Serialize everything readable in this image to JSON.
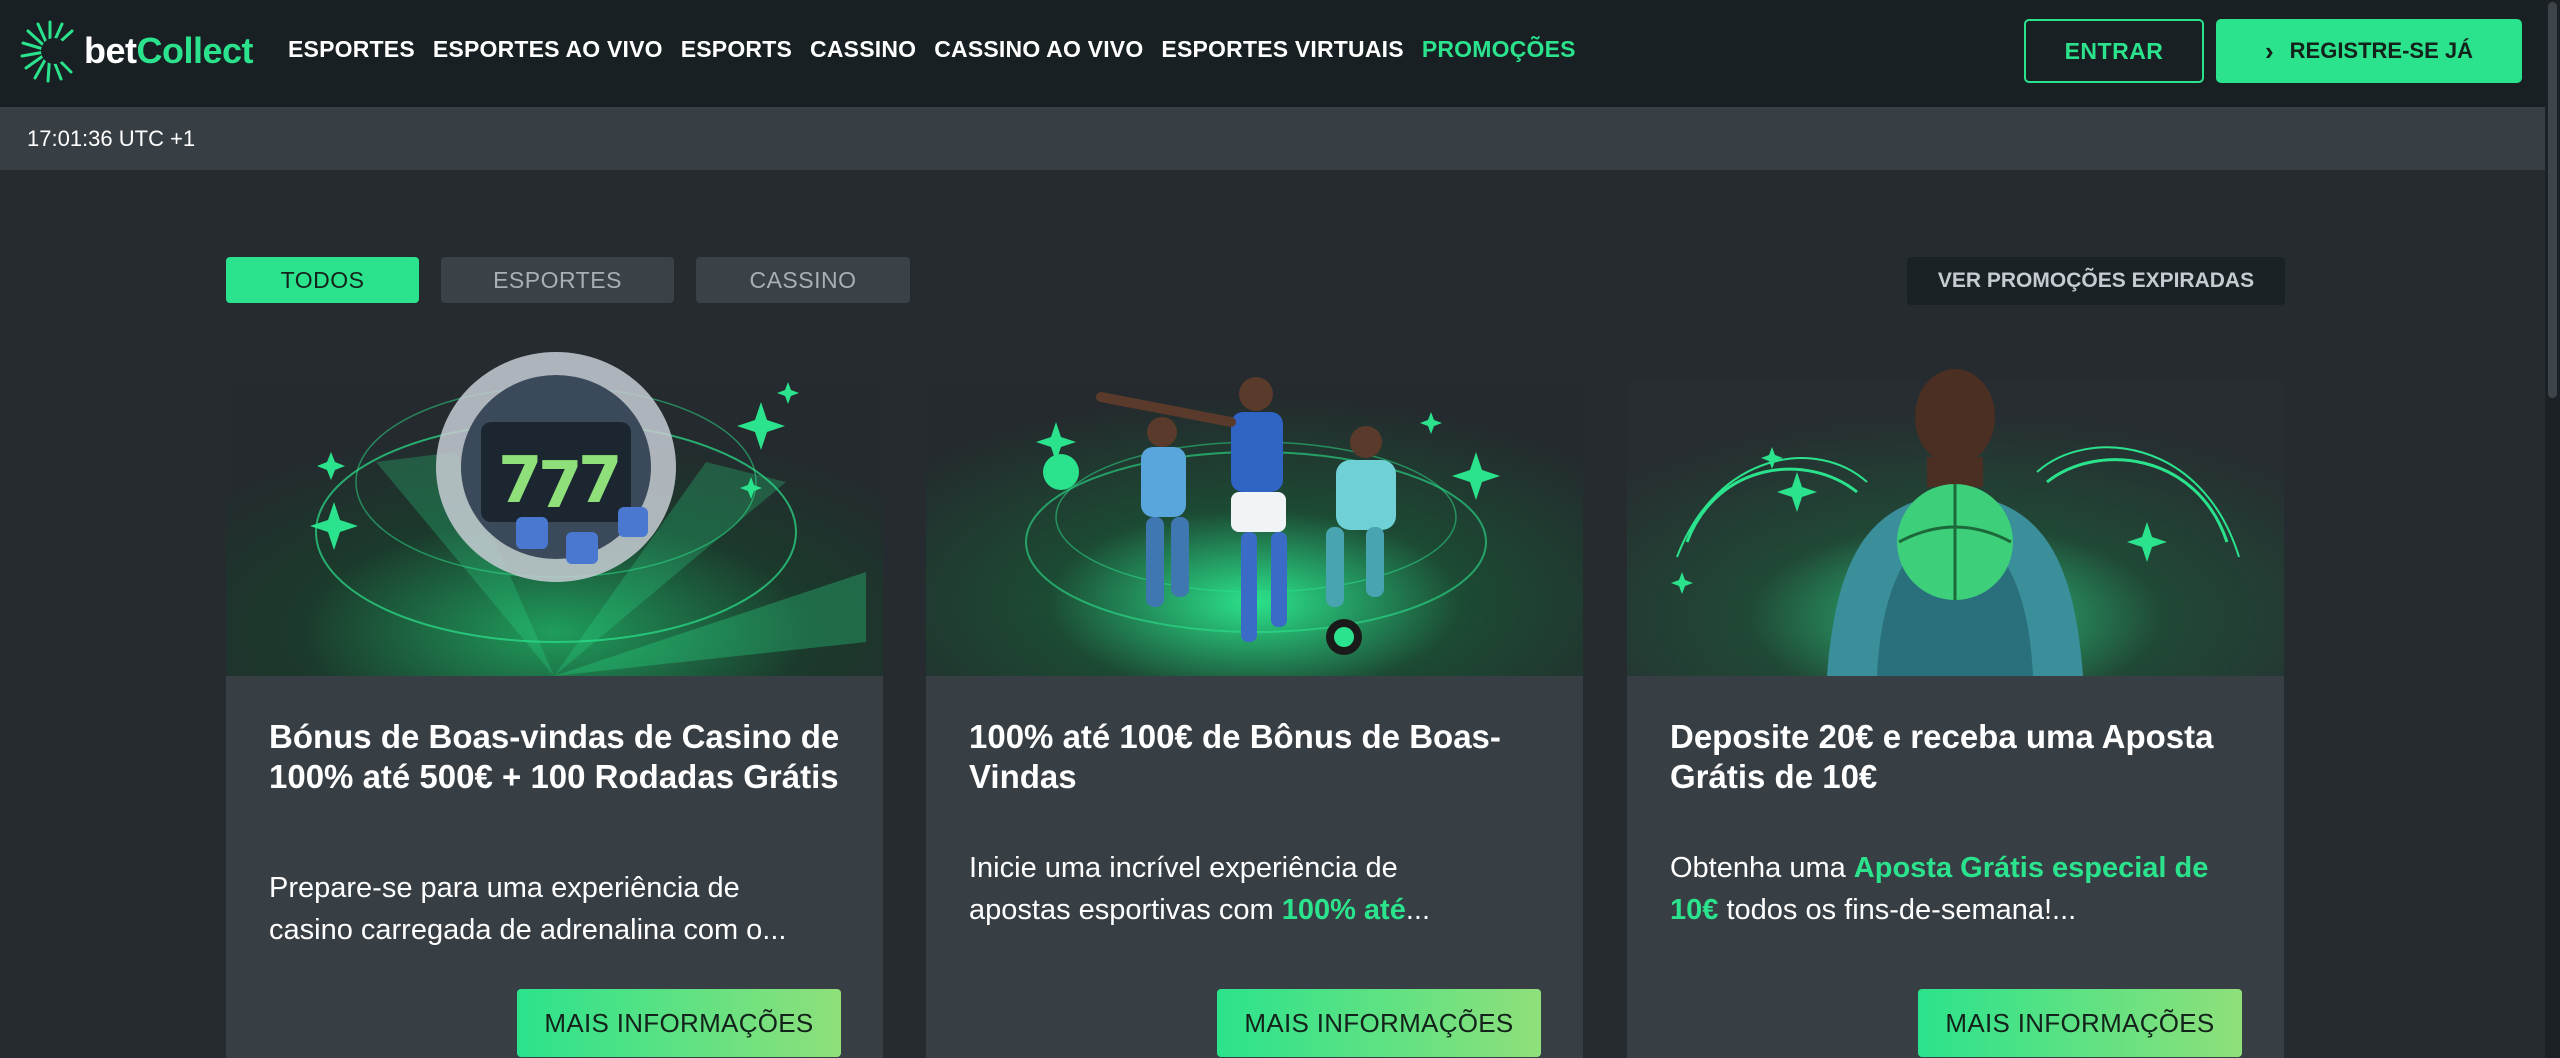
{
  "brand": {
    "bet": "bet",
    "collect": "Collect",
    "accent": "#2be38c"
  },
  "nav": {
    "items": [
      "ESPORTES",
      "ESPORTES AO VIVO",
      "ESPORTS",
      "CASSINO",
      "CASSINO AO VIVO",
      "ESPORTES VIRTUAIS",
      "PROMOÇÕES"
    ],
    "active": "PROMOÇÕES"
  },
  "auth": {
    "login_label": "ENTRAR",
    "register_label": "REGISTRE-SE JÁ"
  },
  "clock": {
    "time": "17:01:36 UTC +1"
  },
  "filters": {
    "all": "TODOS",
    "sports": "ESPORTES",
    "casino": "CASSINO",
    "active": "TODOS"
  },
  "expired_label": "VER PROMOÇÕES EXPIRADAS",
  "cards": [
    {
      "title": "Bónus de Boas-vindas de Casino de 100% até 500€ + 100 Rodadas Grátis",
      "desc_line1": "Prepare-se para uma experiência de",
      "desc_line2": "casino carregada de adrenalina com o...",
      "button": "MAIS INFORMAÇÕES"
    },
    {
      "title": "100% até 100€ de Bônus de Boas-Vindas",
      "desc_line1": "Inicie uma incrível experiência de",
      "desc_line2_pre": "apostas esportivas com ",
      "desc_line2_hl": "100% até",
      "desc_line2_post": "...",
      "button": "MAIS INFORMAÇÕES"
    },
    {
      "title": "Deposite 20€ e receba uma Aposta Grátis de 10€",
      "desc_pre": "Obtenha uma ",
      "desc_hl": "Aposta Grátis especial de 10€",
      "desc_post": " todos os fins-de-semana!...",
      "button": "MAIS INFORMAÇÕES"
    }
  ]
}
